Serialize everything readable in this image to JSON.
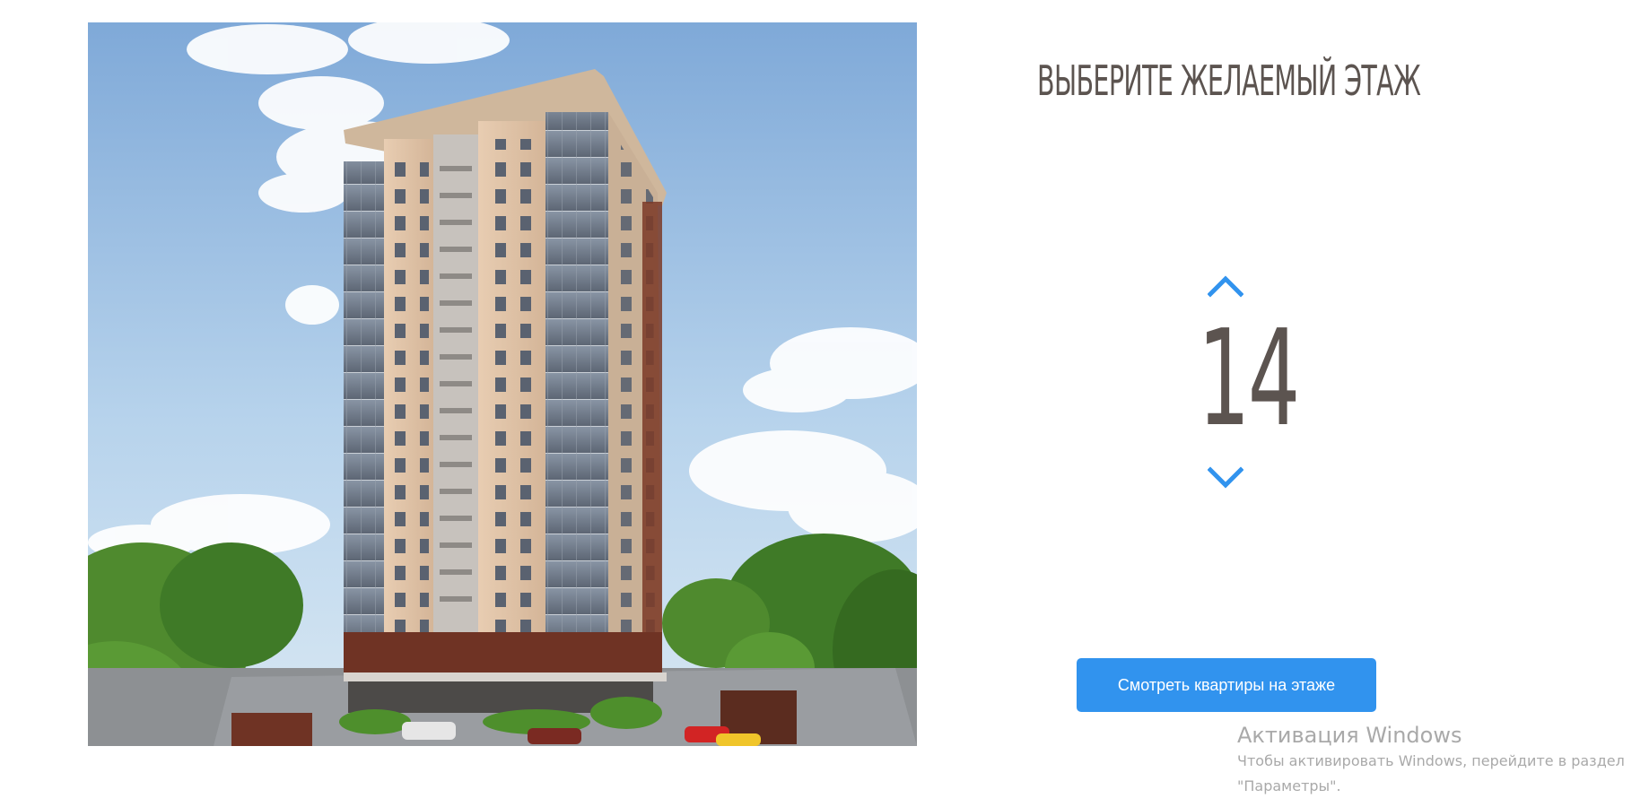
{
  "floor_picker": {
    "title": "ВЫБЕРИТЕ ЖЕЛАЕМЫЙ ЭТАЖ",
    "current_floor": "14",
    "accent_color": "#3193ee",
    "up_icon": "chevron-up-icon",
    "down_icon": "chevron-down-icon",
    "view_button_label": "Смотреть квартиры на этаже"
  },
  "windows_watermark": {
    "title": "Активация Windows",
    "line1": "Чтобы активировать Windows, перейдите в раздел",
    "line2": "\"Параметры\"."
  }
}
